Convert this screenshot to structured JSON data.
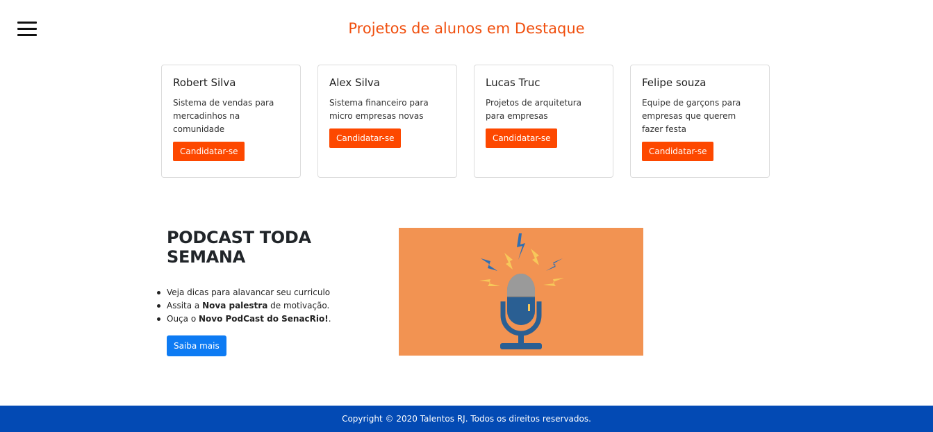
{
  "featured": {
    "title": "Projetos de alunos em Destaque",
    "cards": [
      {
        "name": "Robert Silva",
        "description": "Sistema de vendas para mercadinhos na comunidade",
        "button": "Candidatar-se"
      },
      {
        "name": "Alex Silva",
        "description": "Sistema financeiro para micro empresas novas",
        "button": "Candidatar-se"
      },
      {
        "name": "Lucas Truc",
        "description": "Projetos de arquitetura para empresas",
        "button": "Candidatar-se"
      },
      {
        "name": "Felipe souza",
        "description": "Equipe de garçons para empresas que querem fazer festa",
        "button": "Candidatar-se"
      }
    ]
  },
  "podcast": {
    "title": "PODCAST TODA SEMANA",
    "items": [
      {
        "prefix": "Veja dicas para alavancar seu curriculo",
        "bold": "",
        "suffix": ""
      },
      {
        "prefix": "Assita a ",
        "bold": "Nova palestra",
        "suffix": " de motivação."
      },
      {
        "prefix": "Ouça o ",
        "bold": "Novo PodCast do SenacRio!",
        "suffix": "."
      }
    ],
    "button": "Saiba mais",
    "image_icon": "microphone-icon"
  },
  "footer": {
    "text": "Copyright © 2020 Talentos RJ. Todos os direitos reservados."
  },
  "colors": {
    "accent_orange": "#fd4800",
    "title_orange": "#f04f0e",
    "primary_blue": "#0d7bf3",
    "footer_blue": "#034ab4",
    "podcast_bg": "#f29352"
  }
}
